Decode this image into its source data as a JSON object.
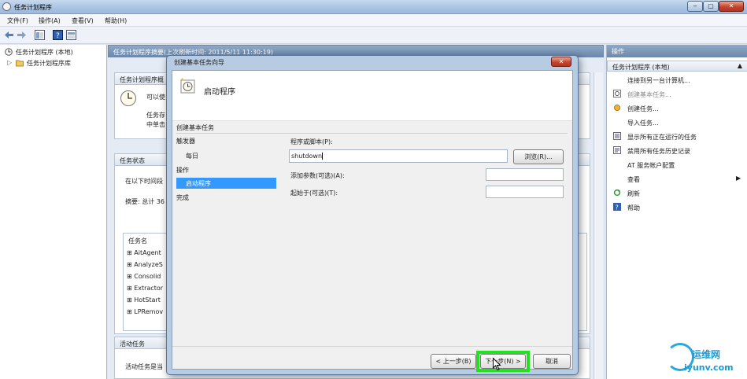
{
  "window": {
    "title": "任务计划程序",
    "controls": [
      "‒",
      "▢",
      "✕"
    ]
  },
  "menubar": [
    "文件(F)",
    "操作(A)",
    "查看(V)",
    "帮助(H)"
  ],
  "tree": {
    "root": "任务计划程序 (本地)",
    "child": "任务计划程序库"
  },
  "center": {
    "summary_header": "任务计划程序摘要(上次刷新时间: 2011/5/11 11:30:19)",
    "overview_header": "任务计划程序概",
    "overview_lines": [
      "可以使",
      "任务存",
      "中单击"
    ],
    "status_header": "任务状态",
    "status_line": "在以下时间段",
    "summary_line": "摘要: 总计 36",
    "task_col": "任务名",
    "tasks": [
      "AitAgent",
      "AnalyzeS",
      "Consolid",
      "Extractor",
      "HotStart",
      "LPRemov"
    ],
    "active_header": "活动任务",
    "active_line": "活动任务是当"
  },
  "dialog": {
    "title": "创建基本任务向导",
    "step_title": "启动程序",
    "nav": {
      "section": "创建基本任务",
      "items": [
        "触发器",
        "每日",
        "操作",
        "启动程序",
        "完成"
      ]
    },
    "program_label": "程序或脚本(P):",
    "program_value": "shutdown",
    "browse": "浏览(R)...",
    "args_label": "添加参数(可选)(A):",
    "args_value": "",
    "startin_label": "起始于(可选)(T):",
    "startin_value": "",
    "back": "< 上一步(B)",
    "next": "下一步(N) >",
    "cancel": "取消"
  },
  "actions": {
    "header": "操作",
    "section": "任务计划程序 (本地)",
    "items": [
      "连接到另一台计算机...",
      "创建基本任务...",
      "创建任务...",
      "导入任务...",
      "显示所有正在运行的任务",
      "禁用所有任务历史记录",
      "AT 服务帐户配置",
      "查看",
      "刷新",
      "帮助"
    ]
  },
  "watermark": {
    "cn": "运维网",
    "url": "iyunv.com"
  },
  "colors": {
    "accent": "#3399ff",
    "highlight_border": "#22e022",
    "titlebar": "#aac4e2"
  }
}
